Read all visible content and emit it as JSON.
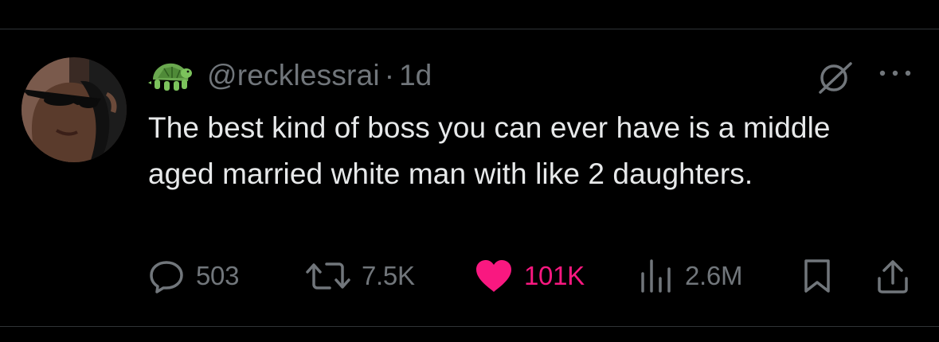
{
  "post": {
    "handle": "@recklessrai",
    "separator": "·",
    "time": "1d",
    "text": "The best kind of boss you can ever have is a middle aged married white man with like 2 daughters.",
    "badge_icon": "turtle-emoji-icon",
    "avatar_icon": "profile-photo"
  },
  "actions": {
    "replies": "503",
    "reposts": "7.5K",
    "likes": "101K",
    "views": "2.6M",
    "liked": true
  },
  "colors": {
    "background": "#000000",
    "text": "#e7e9ea",
    "muted": "#71767b",
    "like": "#f91880",
    "divider": "#2f3336"
  }
}
